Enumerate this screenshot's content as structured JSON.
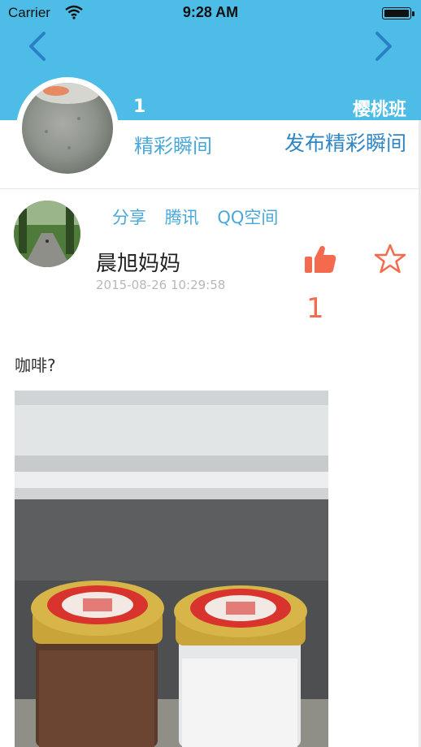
{
  "status_bar": {
    "carrier": "Carrier",
    "time": "9:28 AM"
  },
  "header": {
    "count": "1",
    "class_name": "樱桃班"
  },
  "subheader": {
    "moments_label": "精彩瞬间",
    "publish_button": "发布精彩瞬间"
  },
  "post": {
    "share_links": [
      "分享",
      "腾讯",
      "QQ空间"
    ],
    "author": "晨旭妈妈",
    "timestamp": "2015-08-26 10:29:58",
    "like_count": "1",
    "content": "咖啡?"
  },
  "colors": {
    "header_bg": "#4dbde8",
    "accent": "#4aa8d8",
    "like": "#f46a4e"
  },
  "icons": [
    "wifi-icon",
    "battery-icon",
    "chevron-left-icon",
    "chevron-right-icon",
    "thumbs-up-icon",
    "star-icon"
  ]
}
